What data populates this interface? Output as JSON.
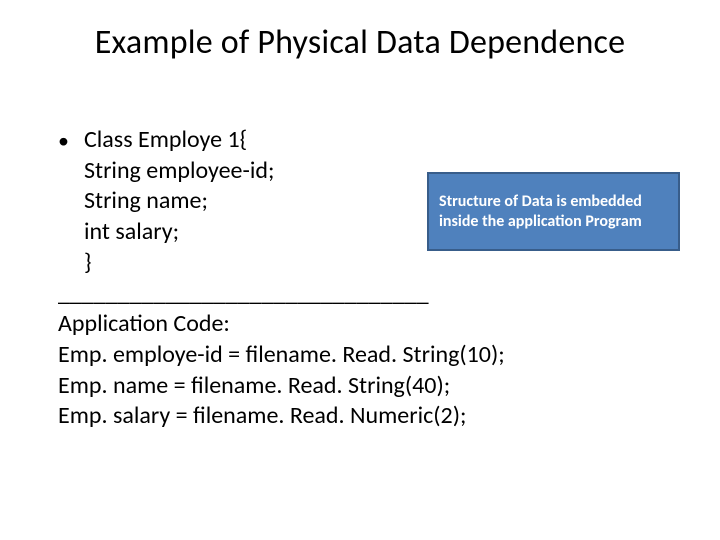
{
  "title": "Example of Physical Data Dependence",
  "bullet": {
    "line1": "Class Employe 1{",
    "line2": "String employee-id;",
    "line3": "String name;",
    "line4": "int salary;",
    "line5": "}"
  },
  "divider": "_______________________________",
  "app": {
    "heading": "Application Code:",
    "line1": "Emp. employe-id = filename. Read. String(10);",
    "line2": "Emp. name = filename. Read. String(40);",
    "line3": "Emp. salary = filename. Read. Numeric(2);"
  },
  "callout": {
    "line1": "Structure of Data is embedded",
    "line2": "inside the application Program"
  }
}
